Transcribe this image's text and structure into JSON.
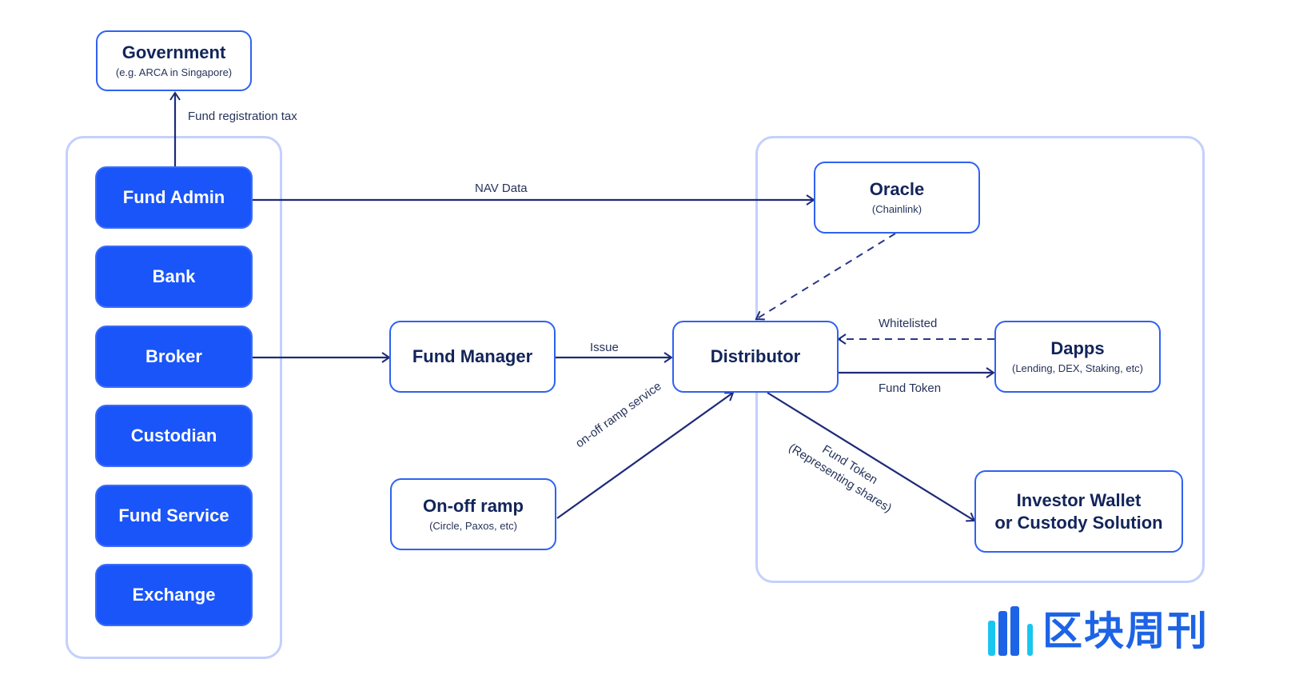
{
  "diagram": {
    "government": {
      "title": "Government",
      "subtitle": "(e.g. ARCA in Singapore)"
    },
    "left_group": {
      "items": [
        {
          "label": "Fund Admin"
        },
        {
          "label": "Bank"
        },
        {
          "label": "Broker"
        },
        {
          "label": "Custodian"
        },
        {
          "label": "Fund Service"
        },
        {
          "label": "Exchange"
        }
      ]
    },
    "fund_manager": {
      "title": "Fund Manager"
    },
    "on_off_ramp": {
      "title": "On-off ramp",
      "subtitle": "(Circle, Paxos, etc)"
    },
    "distributor": {
      "title": "Distributor"
    },
    "oracle": {
      "title": "Oracle",
      "subtitle": "(Chainlink)"
    },
    "dapps": {
      "title": "Dapps",
      "subtitle": "(Lending, DEX, Staking, etc)"
    },
    "investor_wallet": {
      "line1": "Investor Wallet",
      "line2": "or Custody Solution"
    },
    "edges": {
      "fund_registration_tax": "Fund registration tax",
      "nav_data": "NAV Data",
      "issue": "Issue",
      "whitelisted": "Whitelisted",
      "fund_token": "Fund Token",
      "on_off_ramp_service": "on-off ramp service",
      "fund_token_shares_line1": "Fund Token",
      "fund_token_shares_line2": "(Representing shares)"
    },
    "colors": {
      "primary_blue": "#1a55fa",
      "outline_blue": "#2f62f0",
      "group_border": "#c4d0fd",
      "arrow_navy": "#1e2a78",
      "text_navy": "#12245a"
    }
  },
  "watermark": {
    "text": "区块周刊"
  }
}
